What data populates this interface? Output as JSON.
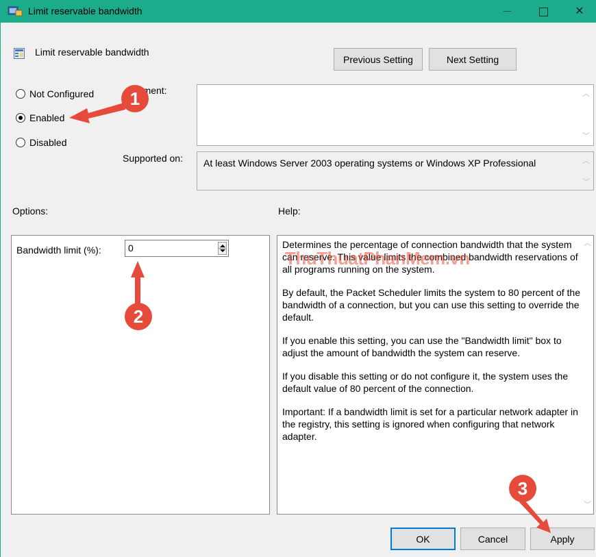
{
  "window": {
    "title": "Limit reservable bandwidth",
    "minimize_icon": "minimize-icon",
    "maximize_icon": "maximize-icon",
    "close_glyph": "✕"
  },
  "header": {
    "policy_name": "Limit reservable bandwidth",
    "previous_label": "Previous Setting",
    "next_label": "Next Setting"
  },
  "state": {
    "options": [
      {
        "label": "Not Configured",
        "checked": false
      },
      {
        "label": "Enabled",
        "checked": true
      },
      {
        "label": "Disabled",
        "checked": false
      }
    ]
  },
  "comment": {
    "label_visible": "ment:",
    "value": ""
  },
  "supported": {
    "label": "Supported on:",
    "value": "At least Windows Server 2003 operating systems or Windows XP Professional"
  },
  "options_section": {
    "label": "Options:",
    "bandwidth_label": "Bandwidth limit (%):",
    "bandwidth_value": "0"
  },
  "help_section": {
    "label": "Help:",
    "paragraphs": [
      "Determines the percentage of connection bandwidth that the system can reserve. This value limits the combined bandwidth reservations of all programs running on the system.",
      "By default, the Packet Scheduler limits the system to 80 percent of the bandwidth of a connection, but you can use this setting to override the default.",
      "If you enable this setting, you can use the \"Bandwidth limit\" box to adjust the amount of bandwidth the system can reserve.",
      "If you disable this setting or do not configure it, the system uses the default value of 80 percent of the connection.",
      "Important: If a bandwidth limit is set for a particular network adapter in the registry, this setting is ignored when configuring that network adapter."
    ]
  },
  "footer": {
    "ok_label": "OK",
    "cancel_label": "Cancel",
    "apply_label": "Apply"
  },
  "annotations": {
    "step1": "1",
    "step2": "2",
    "step3": "3",
    "watermark": "ThuThuatPhanMem.vn"
  },
  "colors": {
    "titlebar": "#1dac8b",
    "callout": "#e64a3b",
    "ok_border": "#0078d7"
  }
}
